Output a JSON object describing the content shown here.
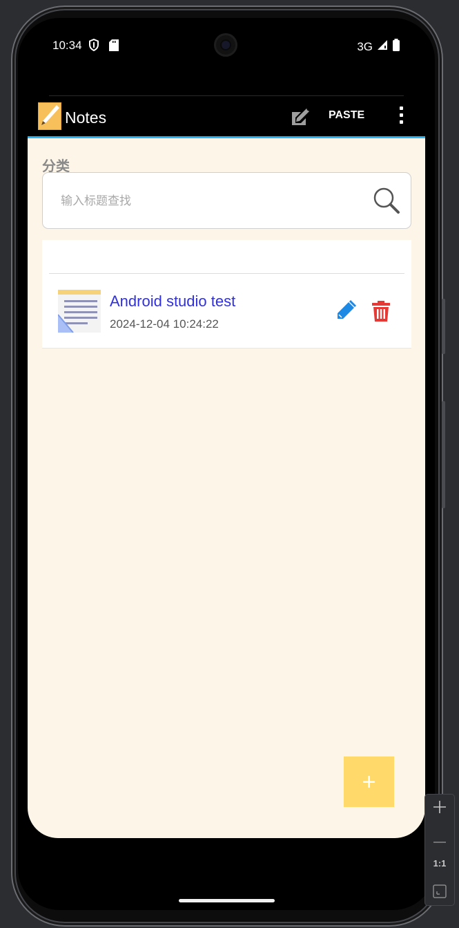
{
  "status_bar": {
    "time": "10:34",
    "network": "3G"
  },
  "toolbar": {
    "title": "Notes",
    "paste_label": "PASTE"
  },
  "category_label": "分类",
  "search": {
    "placeholder": "输入标题查找",
    "value": ""
  },
  "notes": [
    {
      "title": "Android studio test",
      "date": "2024-12-04 10:24:22"
    }
  ],
  "fab_label": "+",
  "emulator_zoom": {
    "reset_label": "1:1"
  },
  "colors": {
    "toolbar_bg": "#000000",
    "accent_underline": "#29b6f6",
    "content_bg": "#fdf5e8",
    "note_title": "#3030e0",
    "edit_icon": "#1e88e5",
    "delete_icon": "#e53935",
    "fab": "#ffda6a"
  }
}
